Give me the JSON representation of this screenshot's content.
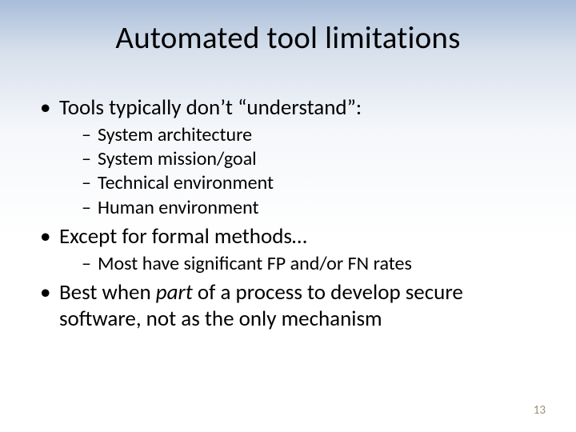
{
  "title": "Automated tool limitations",
  "bullets": {
    "b1": "Tools typically don’t “understand”:",
    "b1_sub": {
      "s1": "System architecture",
      "s2": "System mission/goal",
      "s3": "Technical environment",
      "s4": "Human environment"
    },
    "b2": "Except for formal methods…",
    "b2_sub": {
      "s1": "Most have significant FP and/or FN rates"
    },
    "b3_pre": "Best when ",
    "b3_italic": "part",
    "b3_post": " of a process to develop secure software, not as the only mechanism"
  },
  "page_number": "13"
}
